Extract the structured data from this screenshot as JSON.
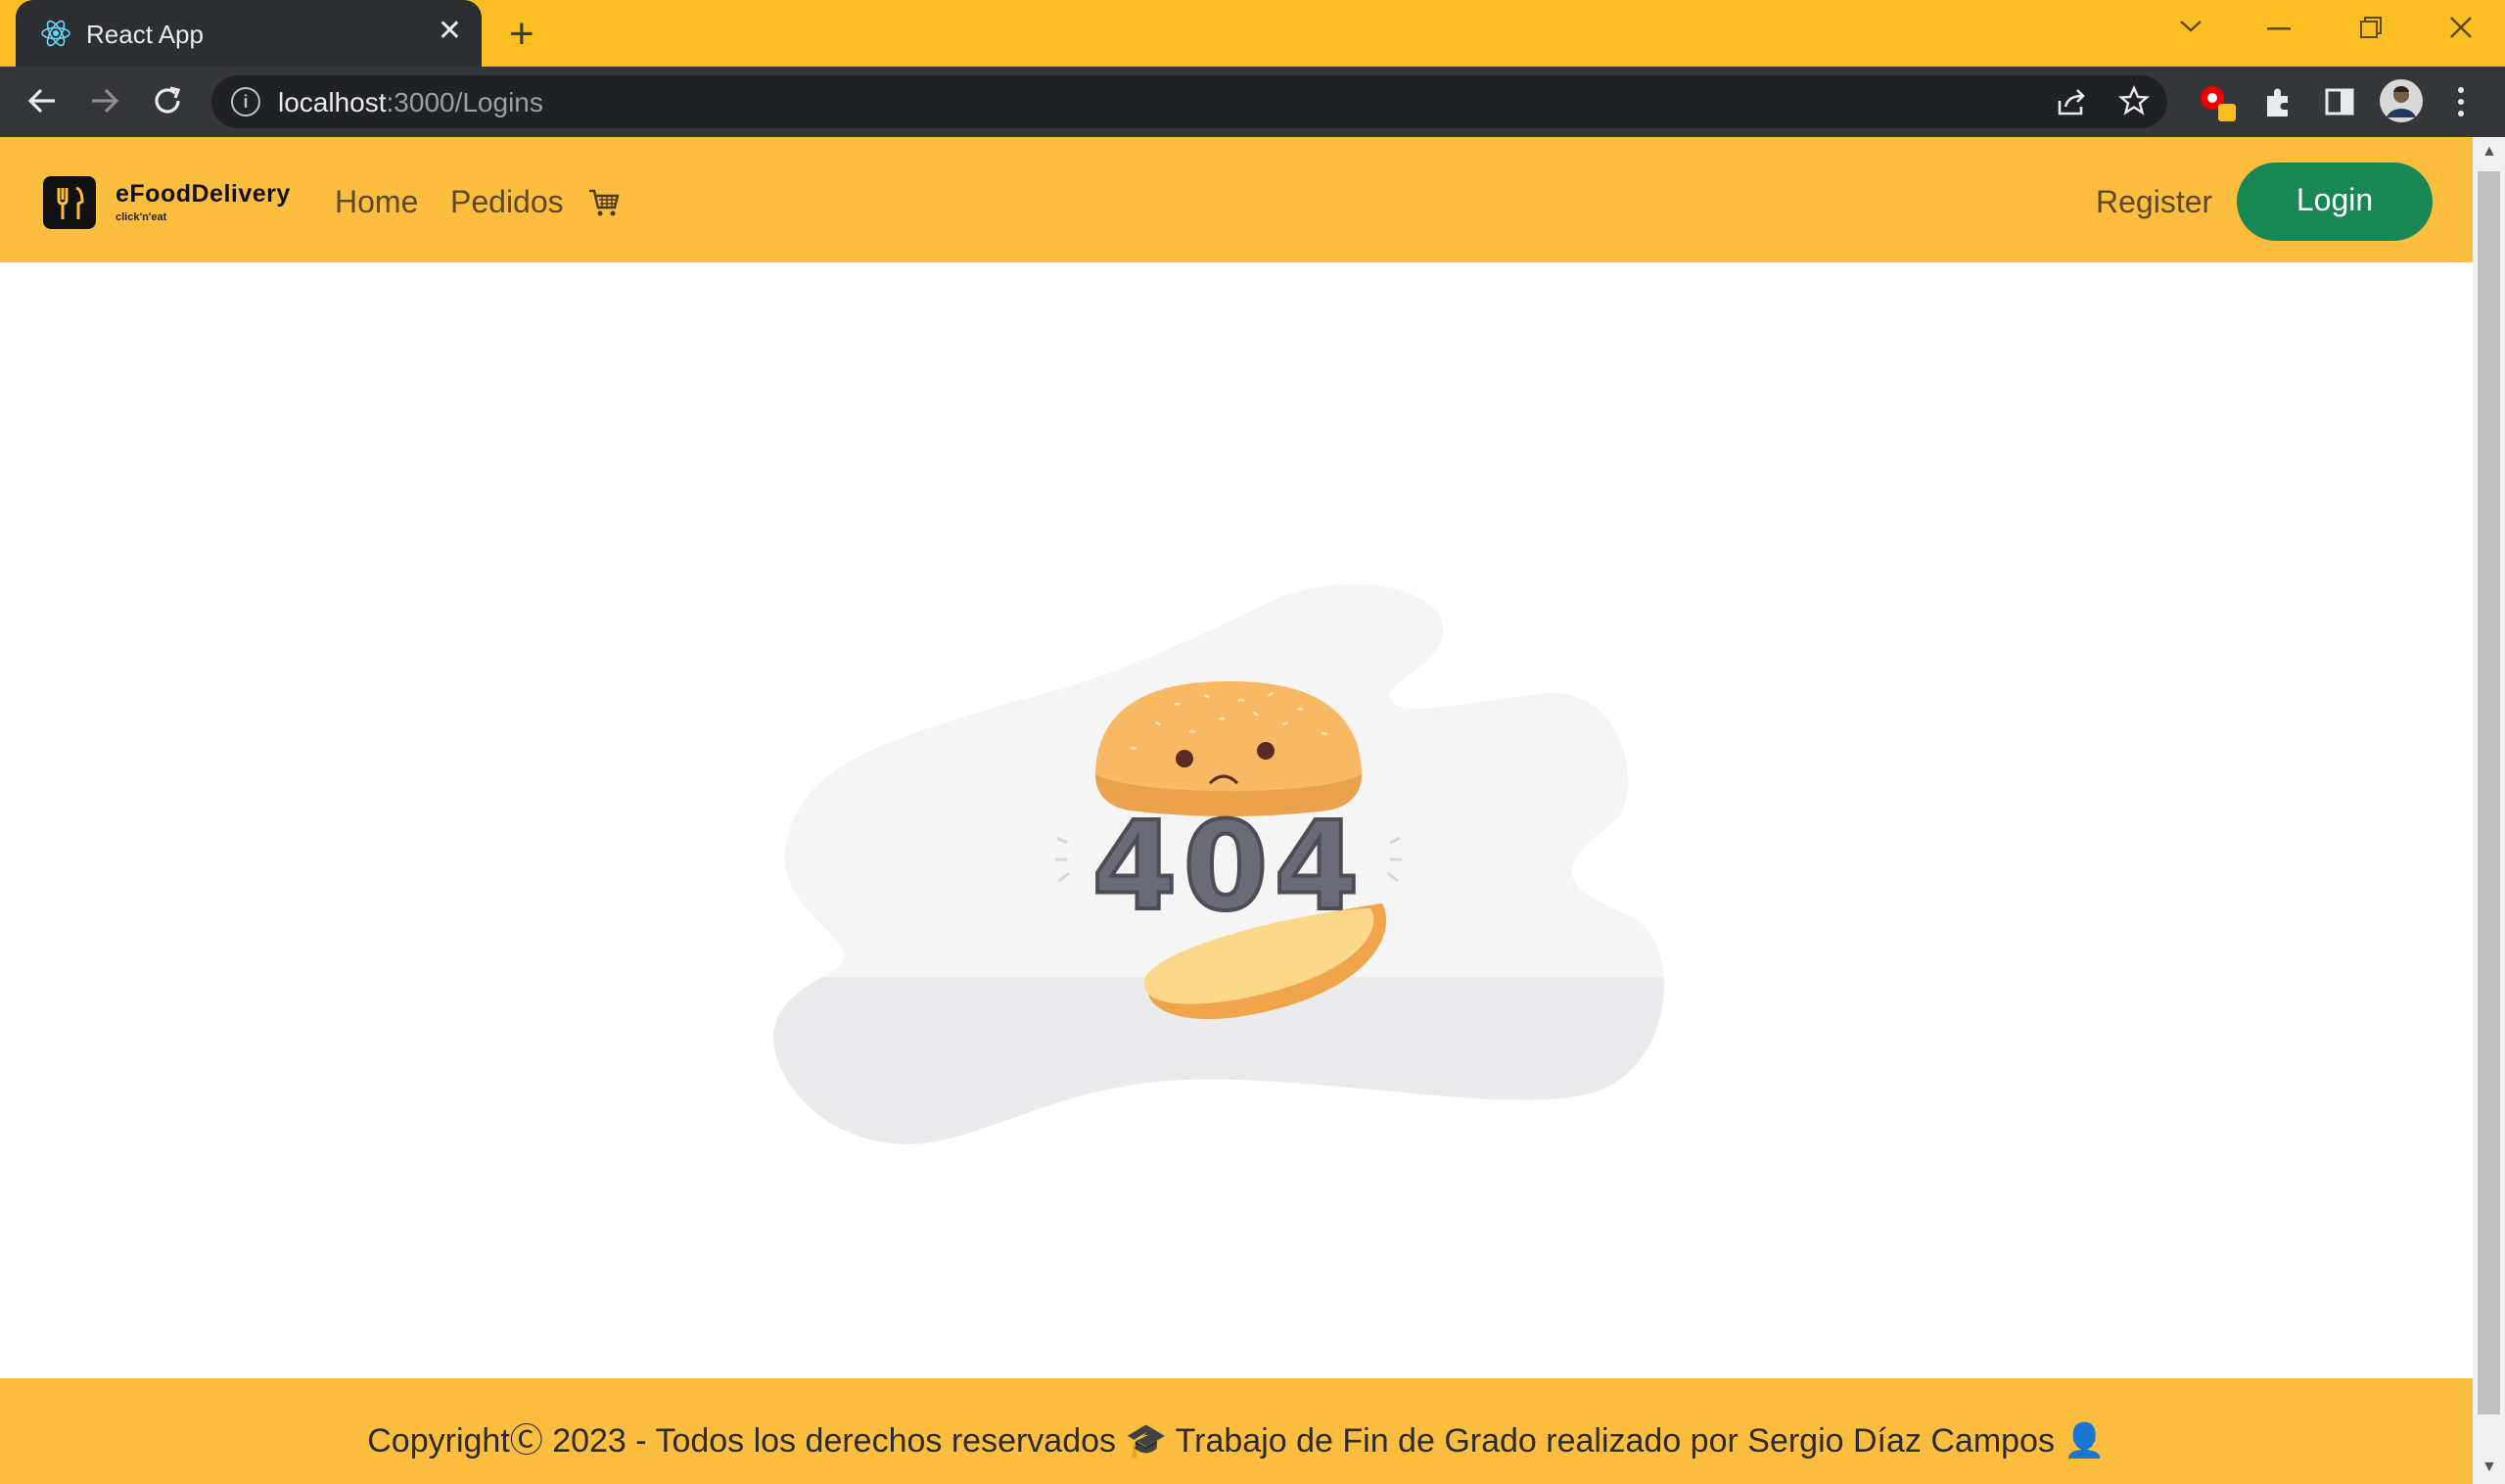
{
  "browser": {
    "tab_title": "React App",
    "url_host": "localhost",
    "url_rest": ":3000/Logins",
    "accent_color": "#fbbf24"
  },
  "navbar": {
    "brand_name": "eFoodDelivery",
    "brand_tagline": "click'n'eat",
    "home_label": "Home",
    "pedidos_label": "Pedidos",
    "register_label": "Register",
    "login_label": "Login",
    "cart_icon": "cart-icon",
    "bg_color": "#fdbd3f",
    "login_color": "#198754"
  },
  "main": {
    "error_code": "404"
  },
  "footer": {
    "text": "CopyrightⒸ 2023 - Todos los derechos reservados 🎓 Trabajo de Fin de Grado realizado por Sergio Díaz Campos 👤"
  }
}
